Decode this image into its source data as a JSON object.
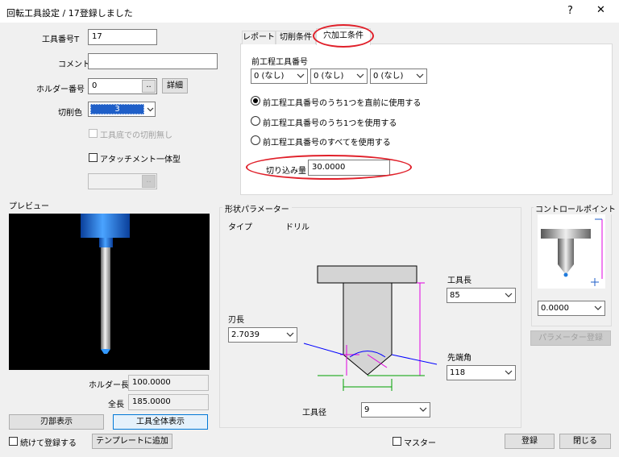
{
  "window": {
    "title": "回転工具設定 / 17登録しました",
    "help": "?",
    "close": "✕"
  },
  "left": {
    "tool_no_label": "工具番号T",
    "tool_no_value": "17",
    "comment_label": "コメント",
    "comment_value": "",
    "holder_label": "ホルダー番号",
    "holder_value": "0",
    "holder_btn": "..",
    "detail_btn": "詳細",
    "color_label": "切削色",
    "color_value": "3",
    "no_cut_label": "工具底での切削無し",
    "attach_label": "アタッチメント一体型",
    "attach_btn": ".."
  },
  "preview": {
    "label": "プレビュー",
    "holder_len_label": "ホルダー長",
    "holder_len_value": "100.0000",
    "total_len_label": "全長",
    "total_len_value": "185.0000",
    "blade_btn": "刃部表示",
    "full_btn": "工具全体表示"
  },
  "tabs": [
    {
      "label": "レポート"
    },
    {
      "label": "切削条件"
    },
    {
      "label": "穴加工条件"
    }
  ],
  "hole": {
    "prev_tool_label": "前工程工具番号",
    "prev_selects": [
      "0 (なし)",
      "0 (なし)",
      "0 (なし)"
    ],
    "radio1": "前工程工具番号のうち1つを直前に使用する",
    "radio2": "前工程工具番号のうち1つを使用する",
    "radio3": "前工程工具番号のすべてを使用する",
    "cut_amount_label": "切り込み量",
    "cut_amount_value": "30.0000"
  },
  "shape": {
    "group_label": "形状パラメーター",
    "type_label": "タイプ",
    "type_value": "ドリル",
    "blade_len_label": "刃長",
    "blade_len_value": "2.7039",
    "tool_len_label": "工具長",
    "tool_len_value": "85",
    "tip_angle_label": "先端角",
    "tip_angle_value": "118",
    "diameter_label": "工具径",
    "diameter_value": "9"
  },
  "control": {
    "group_label": "コントロールポイント",
    "value": "0.0000",
    "register_btn": "パラメーター登録"
  },
  "footer": {
    "continue_label": "続けて登録する",
    "template_btn": "テンプレートに追加",
    "master_label": "マスター",
    "register_btn": "登録",
    "close_btn": "閉じる"
  },
  "colors": {
    "tool_blue": "#1f7bdc",
    "highlight": "#e0202a",
    "magenta": "#e000e0",
    "green": "#00a000"
  }
}
